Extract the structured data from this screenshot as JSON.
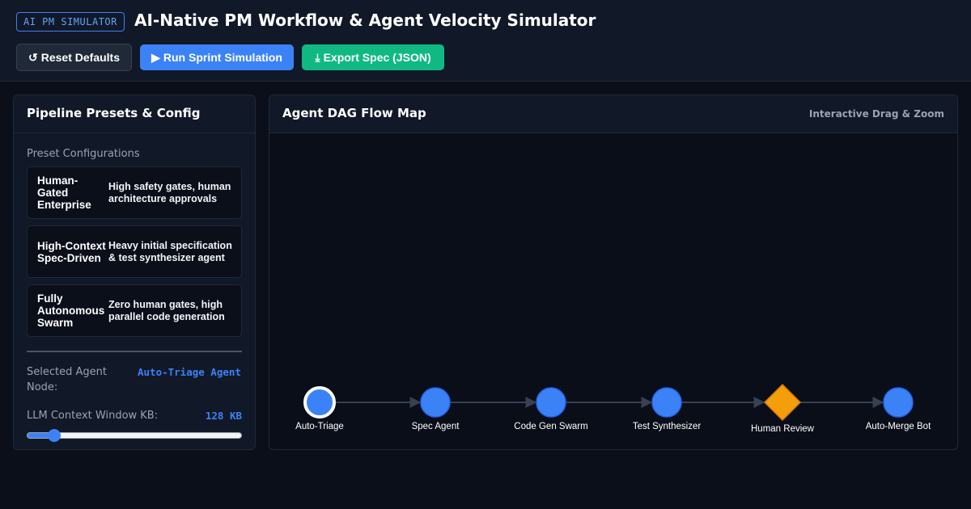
{
  "header": {
    "badge": "AI PM SIMULATOR",
    "title": "AI-Native PM Workflow & Agent Velocity Simulator",
    "buttons": {
      "reset": {
        "icon": "reset-icon",
        "glyph": "↺",
        "label": "Reset Defaults"
      },
      "run": {
        "icon": "play-icon",
        "glyph": "▶",
        "label": "Run Sprint Simulation"
      },
      "export": {
        "icon": "download-icon",
        "glyph": "⤓",
        "label": "Export Spec (JSON)"
      }
    }
  },
  "config_panel": {
    "title": "Pipeline Presets & Config",
    "section_label": "Preset Configurations",
    "presets": [
      {
        "name": "Human-Gated Enterprise",
        "description": "High safety gates, human architecture approvals"
      },
      {
        "name": "High-Context Spec-Driven",
        "description": "Heavy initial specification & test synthesizer agent"
      },
      {
        "name": "Fully Autonomous Swarm",
        "description": "Zero human gates, high parallel code generation"
      }
    ],
    "selected_agent": {
      "label": "Selected Agent Node:",
      "value": "Auto-Triage Agent"
    },
    "context_window": {
      "label": "LLM Context Window KB:",
      "value": "128 KB",
      "fraction": 0.08
    }
  },
  "dag_panel": {
    "title": "Agent DAG Flow Map",
    "hint": "Interactive Drag & Zoom",
    "nodes": [
      {
        "id": "auto-triage",
        "label": "Auto-Triage",
        "shape": "circle",
        "selected": true
      },
      {
        "id": "spec-agent",
        "label": "Spec Agent",
        "shape": "circle",
        "selected": false
      },
      {
        "id": "code-gen-swarm",
        "label": "Code Gen Swarm",
        "shape": "circle",
        "selected": false
      },
      {
        "id": "test-synthesizer",
        "label": "Test Synthesizer",
        "shape": "circle",
        "selected": false
      },
      {
        "id": "human-review",
        "label": "Human Review",
        "shape": "diamond",
        "selected": false
      },
      {
        "id": "auto-merge-bot",
        "label": "Auto-Merge Bot",
        "shape": "circle",
        "selected": false
      }
    ],
    "colors": {
      "agent": "#3b82f6",
      "human_gate": "#f59e0b",
      "edge": "#374151",
      "selected_ring": "#ffffff"
    }
  }
}
